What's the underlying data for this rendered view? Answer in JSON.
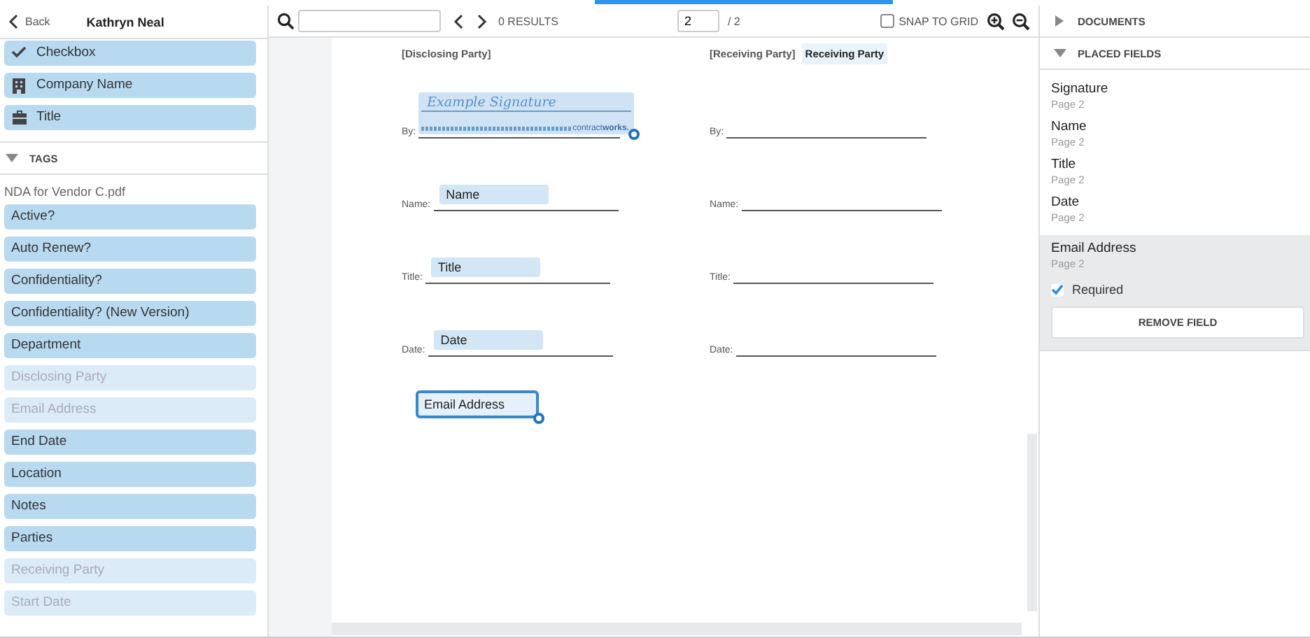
{
  "header": {
    "back": "Back",
    "title": "Kathryn Neal"
  },
  "fields": [
    {
      "label": "Checkbox",
      "kind": "check"
    },
    {
      "label": "Company Name",
      "kind": "building"
    },
    {
      "label": "Title",
      "kind": "briefcase"
    }
  ],
  "tags": {
    "title": "TAGS",
    "expanded": true,
    "document": "NDA for Vendor C.pdf",
    "items": [
      {
        "label": "Active?",
        "disabled": false
      },
      {
        "label": "Auto Renew?",
        "disabled": false
      },
      {
        "label": "Confidentiality?",
        "disabled": false
      },
      {
        "label": "Confidentiality? (New Version)",
        "disabled": false
      },
      {
        "label": "Department",
        "disabled": false
      },
      {
        "label": "Disclosing Party",
        "disabled": true
      },
      {
        "label": "Email Address",
        "disabled": true
      },
      {
        "label": "End Date",
        "disabled": false
      },
      {
        "label": "Location",
        "disabled": false
      },
      {
        "label": "Notes",
        "disabled": false
      },
      {
        "label": "Parties",
        "disabled": false
      },
      {
        "label": "Receiving Party",
        "disabled": true
      },
      {
        "label": "Start Date",
        "disabled": true
      }
    ]
  },
  "toolbar": {
    "results": "0 RESULTS",
    "page": "2",
    "page_total": "/ 2",
    "snap_to_grid": {
      "label": "SNAP TO GRID",
      "checked": false
    }
  },
  "document": {
    "columns": [
      {
        "heading": "[Disclosing Party]",
        "lines": [
          {
            "label": "By:",
            "field": {
              "kind": "signature",
              "text": "Example Signature",
              "brand": "contract**works.**"
            }
          },
          {
            "label": "Name:",
            "field": {
              "kind": "text",
              "text": "Name"
            }
          },
          {
            "label": "Title:",
            "field": {
              "kind": "text",
              "text": "Title"
            }
          },
          {
            "label": "Date:",
            "field": {
              "kind": "text",
              "text": "Date"
            }
          }
        ]
      },
      {
        "heading": "[Receiving Party]",
        "heading_field": "Receiving Party",
        "lines": [
          {
            "label": "By:"
          },
          {
            "label": "Name:"
          },
          {
            "label": "Title:"
          },
          {
            "label": "Date:"
          }
        ]
      }
    ],
    "floating_field": {
      "text": "Email Address",
      "selected": true
    }
  },
  "sections": [
    {
      "title": "DOCUMENTS",
      "expanded": false
    },
    {
      "title": "PLACED FIELDS",
      "expanded": true
    }
  ],
  "placed_fields": [
    {
      "name": "Signature",
      "page": "Page 2",
      "selected": false
    },
    {
      "name": "Name",
      "page": "Page 2",
      "selected": false
    },
    {
      "name": "Title",
      "page": "Page 2",
      "selected": false
    },
    {
      "name": "Date",
      "page": "Page 2",
      "selected": false
    },
    {
      "name": "Email Address",
      "page": "Page 2",
      "selected": true,
      "required": true
    }
  ],
  "required_label": "Required",
  "remove_button": "REMOVE FIELD"
}
